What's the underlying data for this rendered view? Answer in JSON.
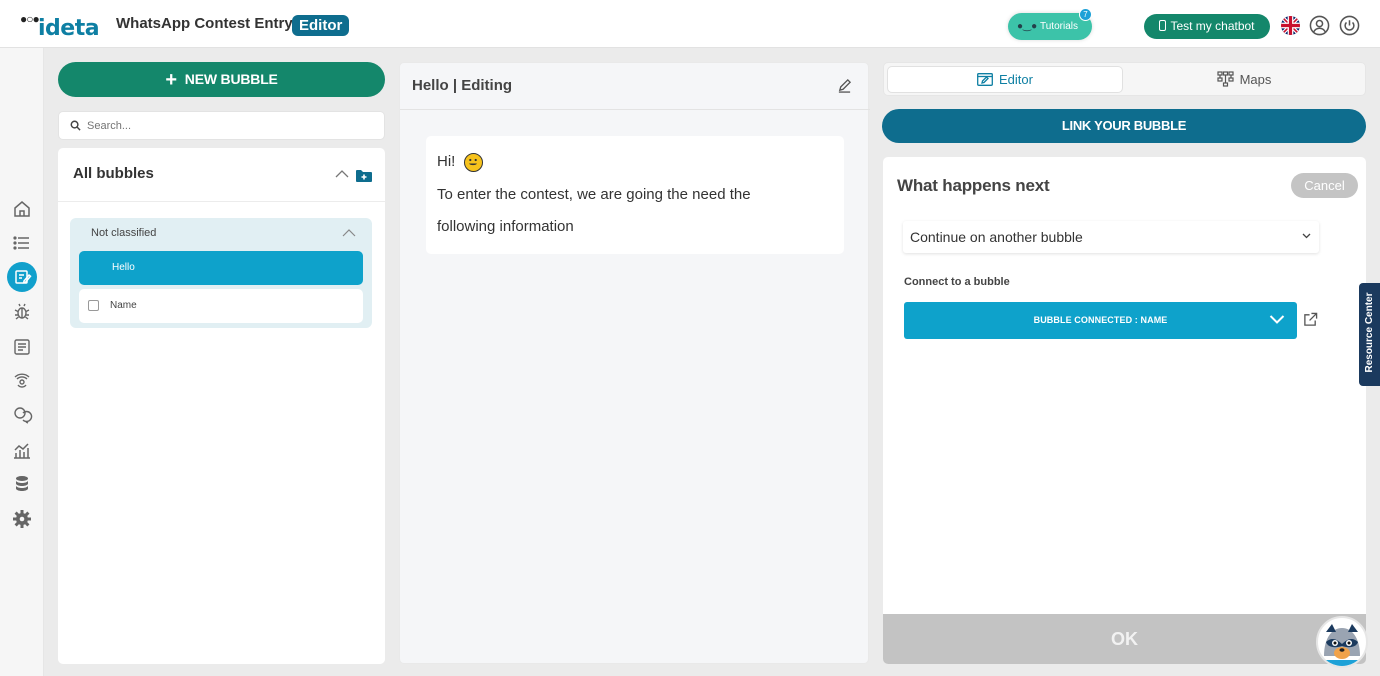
{
  "header": {
    "logo_text": "ideta",
    "app_title": "WhatsApp Contest Entry |",
    "mode_badge": "Editor",
    "tutorials_label": "Tutorials",
    "tutorials_count": "7",
    "test_bot_label": "Test my chatbot",
    "language_icon": "uk-flag-icon",
    "account_icon": "user-icon",
    "power_icon": "power-icon"
  },
  "sidebar": {
    "icons": [
      "home-icon",
      "list-icon",
      "edit-bubbles-icon",
      "bug-icon",
      "form-icon",
      "broadcast-icon",
      "conversations-icon",
      "analytics-icon",
      "database-icon",
      "settings-icon"
    ],
    "active_index": 2
  },
  "bubbles": {
    "new_bubble_label": "NEW BUBBLE",
    "search_placeholder": "Search...",
    "panel_title": "All bubbles",
    "group": {
      "title": "Not classified",
      "items": [
        {
          "label": "Hello",
          "active": true
        },
        {
          "label": "Name",
          "active": false
        }
      ]
    }
  },
  "editing": {
    "title": "Hello  | Editing",
    "message": {
      "line1": "Hi!",
      "line2": "To enter the contest, we are going the need the",
      "line3": "following information"
    }
  },
  "config": {
    "tabs": [
      {
        "label": "Editor",
        "active": true
      },
      {
        "label": "Maps",
        "active": false
      }
    ],
    "link_label": "LINK YOUR BUBBLE",
    "next_title": "What happens next",
    "cancel_label": "Cancel",
    "next_action": "Continue on another bubble",
    "connect_label": "Connect to a bubble",
    "connected_label": "BUBBLE CONNECTED : NAME",
    "ok_label": "OK"
  },
  "resource_center_label": "Resource Center",
  "colors": {
    "primary_green": "#14876b",
    "primary_blue": "#0e6d8e",
    "accent_cyan": "#0ea2cb",
    "tutorials_teal": "#3cc3a9"
  }
}
